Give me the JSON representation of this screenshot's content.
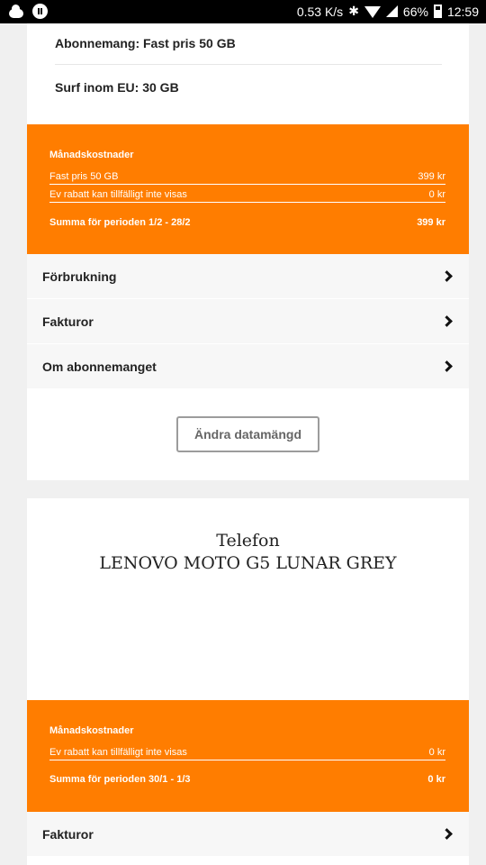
{
  "statusbar": {
    "speed": "0.53 K/s",
    "battery": "66%",
    "time": "12:59"
  },
  "subscription": {
    "plan_label": "Abonnemang: Fast pris 50 GB",
    "eu_label": "Surf inom EU: 30 GB",
    "costs": {
      "title": "Månadskostnader",
      "lines": [
        {
          "label": "Fast pris 50 GB",
          "amount": "399 kr"
        },
        {
          "label": "Ev rabatt kan tillfälligt inte visas",
          "amount": "0 kr"
        }
      ],
      "total_label": "Summa för perioden 1/2 - 28/2",
      "total_amount": "399 kr"
    },
    "nav": [
      {
        "label": "Förbrukning"
      },
      {
        "label": "Fakturor"
      },
      {
        "label": "Om abonnemanget"
      }
    ],
    "change_button": "Ändra datamängd"
  },
  "phone": {
    "heading": "Telefon",
    "model": "LENOVO MOTO G5 LUNAR GREY",
    "costs": {
      "title": "Månadskostnader",
      "lines": [
        {
          "label": "Ev rabatt kan tillfälligt inte visas",
          "amount": "0 kr"
        }
      ],
      "total_label": "Summa för perioden 30/1 - 1/3",
      "total_amount": "0 kr"
    },
    "nav": [
      {
        "label": "Fakturor"
      }
    ]
  }
}
